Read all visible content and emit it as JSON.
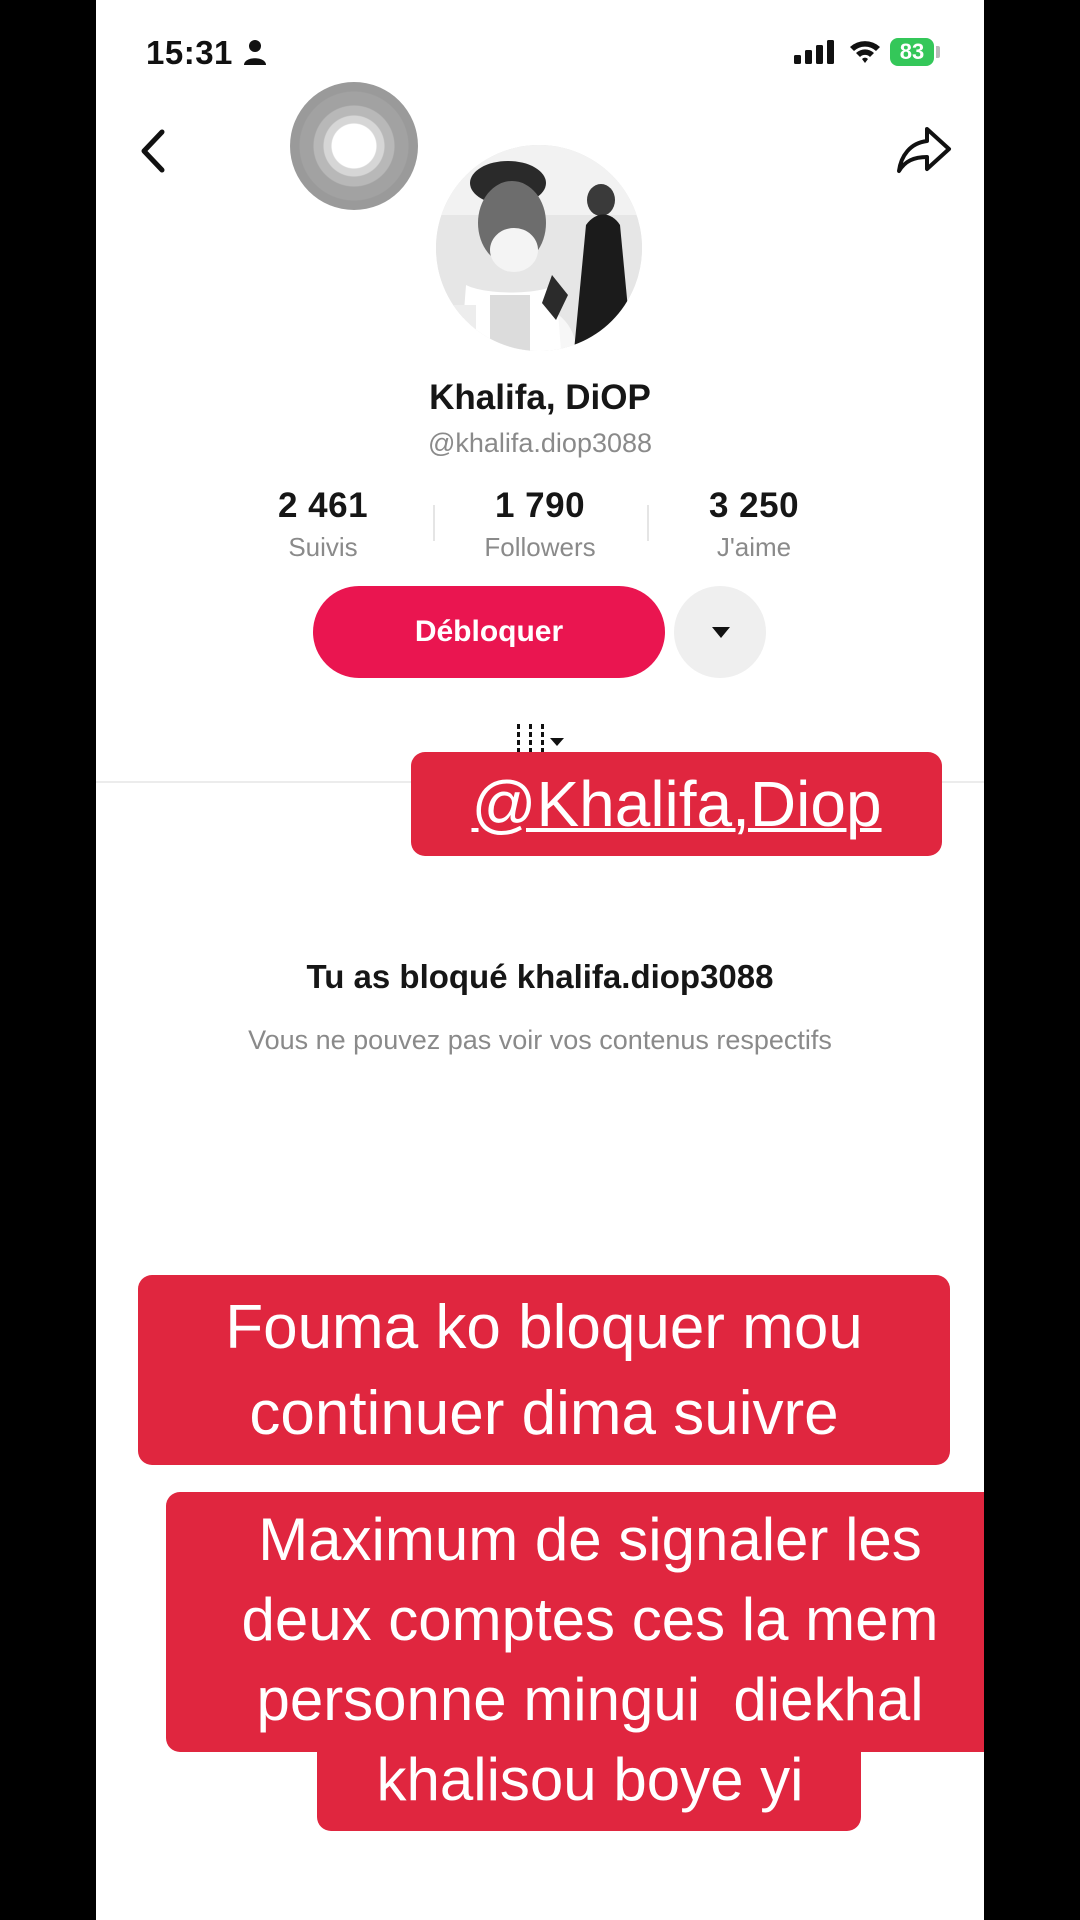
{
  "status_bar": {
    "time": "15:31",
    "battery": "83"
  },
  "profile": {
    "display_name": "Khalifa, DiOP",
    "handle": "@khalifa.diop3088",
    "stats": [
      {
        "value": "2 461",
        "label": "Suivis"
      },
      {
        "value": "1 790",
        "label": "Followers"
      },
      {
        "value": "3 250",
        "label": "J'aime"
      }
    ],
    "unblock_label": "Débloquer"
  },
  "blocked_notice": {
    "title": "Tu as bloqué khalifa.diop3088",
    "subtitle": "Vous ne pouvez pas voir vos contenus respectifs"
  },
  "captions": {
    "mention": "@Khalifa,Diop",
    "block_line1": "Fouma ko bloquer mou",
    "block_line2": "continuer dima suivre",
    "report_line1": "Maximum de signaler les",
    "report_line2": "deux comptes ces la mem",
    "report_line3": "personne mingui  diekhal",
    "report_line4": "khalisou boye yi"
  },
  "icons": [
    "person-icon",
    "signal-icon",
    "wifi-icon",
    "back-icon",
    "share-icon",
    "dropdown-icon",
    "tab-grid-icon"
  ],
  "colors": {
    "accent": "#ea1550",
    "caption_bg": "#e0263f",
    "battery": "#34c759"
  }
}
